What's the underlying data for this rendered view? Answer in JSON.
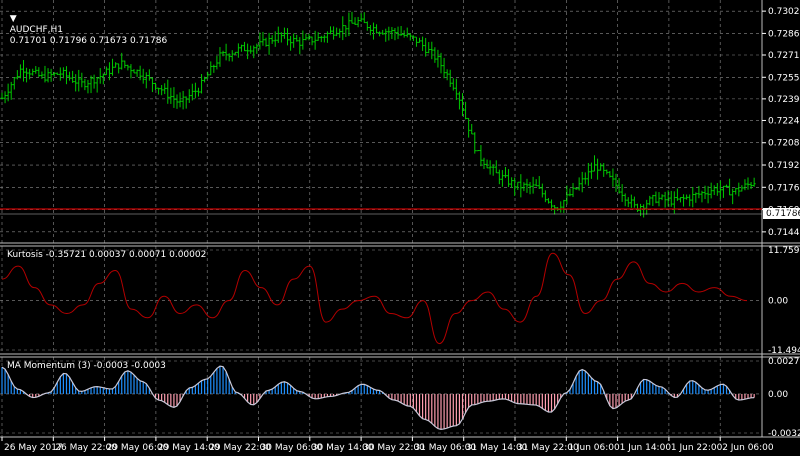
{
  "main": {
    "symbol": "AUDCHF,H1",
    "ohlc": "0.71701 0.71796 0.71673 0.71786",
    "current_price": "0.71786",
    "price_ticks": [
      "0.73025",
      "0.72865",
      "0.72710",
      "0.72550",
      "0.72395",
      "0.72240",
      "0.72080",
      "0.71920",
      "0.71760",
      "0.71600",
      "0.71440"
    ]
  },
  "kurtosis": {
    "label": "Kurtosis -0.35721 0.00037 0.00071 0.00002",
    "ticks": [
      "11.7595",
      "0.00",
      "-11.49406"
    ]
  },
  "momentum": {
    "label": "MA Momentum (3) -0.0003 -0.0003",
    "ticks": [
      "0.0027",
      "0.00",
      "-0.0032"
    ]
  },
  "time_labels": [
    "26 May 2017",
    "26 May 22:00",
    "29 May 06:00",
    "29 May 14:00",
    "29 May 22:00",
    "30 May 06:00",
    "30 May 14:00",
    "30 May 22:00",
    "31 May 06:00",
    "31 May 14:00",
    "31 May 22:00",
    "1 Jun 06:00",
    "1 Jun 14:00",
    "1 Jun 22:00",
    "2 Jun 06:00"
  ],
  "colors": {
    "background": "#000000",
    "grid": "#8c8c8c",
    "bars": "#00c800",
    "price_line": "#c80000",
    "kurtosis_line": "#b40000",
    "momentum_pos": "#1e90ff",
    "momentum_neg": "#ff9eb0",
    "momentum_line": "#c8c8d8"
  },
  "chart_data": [
    {
      "type": "ohlc",
      "title": "AUDCHF,H1",
      "ylim": [
        0.7136,
        0.73105
      ],
      "current_price": 0.71786,
      "y_ticks": [
        0.73025,
        0.72865,
        0.7271,
        0.7255,
        0.72395,
        0.7224,
        0.7208,
        0.7192,
        0.7176,
        0.716,
        0.7144
      ],
      "close_path": [
        0.724,
        0.7262,
        0.7255,
        0.7258,
        0.725,
        0.7256,
        0.7265,
        0.7258,
        0.7247,
        0.7236,
        0.7248,
        0.727,
        0.7275,
        0.7278,
        0.7285,
        0.728,
        0.7283,
        0.729,
        0.7295,
        0.7289,
        0.7287,
        0.7281,
        0.7268,
        0.7245,
        0.72,
        0.7185,
        0.7177,
        0.7176,
        0.7161,
        0.7175,
        0.7192,
        0.7178,
        0.7161,
        0.7168,
        0.7166,
        0.717,
        0.7175,
        0.7173,
        0.718
      ]
    },
    {
      "type": "line",
      "title": "Kurtosis",
      "ylim": [
        -11.49406,
        11.7595
      ],
      "values": [
        5,
        8,
        3,
        -1,
        -3,
        -1,
        4,
        7,
        -2,
        -4,
        1,
        -3,
        -1,
        -4,
        0,
        7,
        3,
        -1,
        5,
        8,
        -5,
        -2,
        0,
        1,
        -3,
        -4,
        0,
        -10,
        -3,
        0,
        2,
        -2,
        -5,
        1,
        11,
        6,
        -3,
        0,
        5,
        9,
        4,
        2,
        4,
        2,
        3,
        1,
        0
      ]
    },
    {
      "type": "bar",
      "title": "MA Momentum (3)",
      "ylim": [
        -0.0032,
        0.0027
      ],
      "values": [
        0.0022,
        0.0004,
        -0.0003,
        0.0001,
        0.0017,
        0.0002,
        0.0006,
        0.0004,
        0.0019,
        0.001,
        -0.0005,
        -0.0011,
        0.0005,
        0.0012,
        0.0023,
        0.0001,
        -0.0009,
        0.0003,
        0.001,
        0.0002,
        -0.0004,
        -0.0002,
        0.0001,
        0.0008,
        0.0003,
        -0.0005,
        -0.001,
        -0.0021,
        -0.0029,
        -0.0026,
        -0.0009,
        -0.0006,
        -0.0004,
        -0.0008,
        -0.0009,
        -0.0015,
        0.0001,
        0.002,
        0.001,
        -0.0012,
        -0.0005,
        0.0012,
        0.0006,
        -0.0003,
        0.0011,
        0.0003,
        0.0008,
        -0.0005,
        -0.0003
      ]
    }
  ]
}
